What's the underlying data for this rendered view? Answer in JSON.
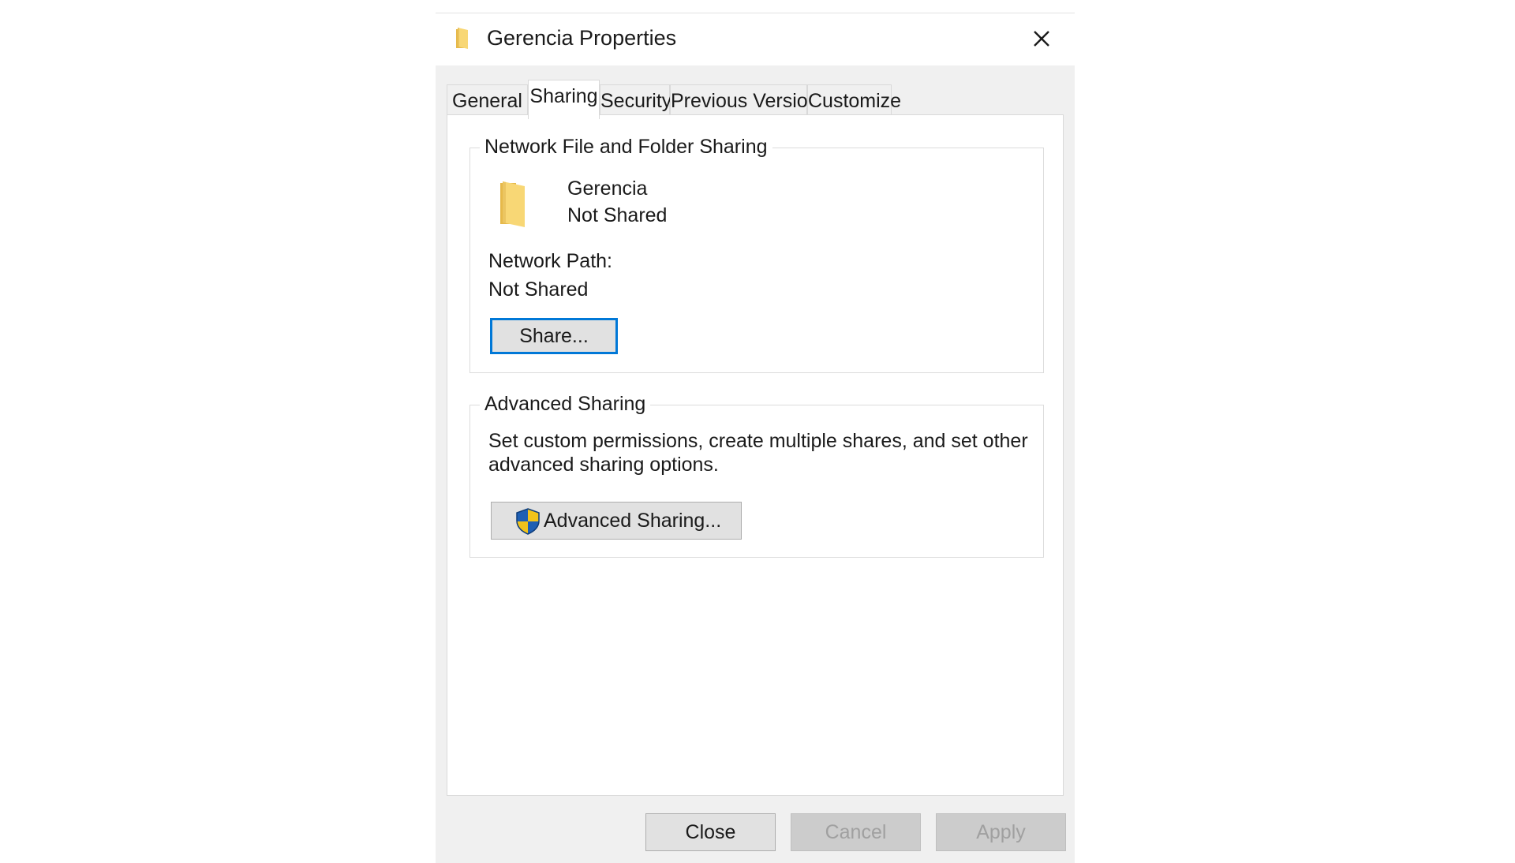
{
  "window": {
    "title": "Gerencia Properties",
    "icon": "folder-icon",
    "close_icon": "close-icon"
  },
  "tabs": [
    {
      "label": "General",
      "active": false
    },
    {
      "label": "Sharing",
      "active": true
    },
    {
      "label": "Security",
      "active": false
    },
    {
      "label": "Previous Versions",
      "active": false
    },
    {
      "label": "Customize",
      "active": false
    }
  ],
  "network_sharing": {
    "group_label": "Network File and Folder Sharing",
    "folder_icon": "folder-icon",
    "folder_name": "Gerencia",
    "folder_status": "Not Shared",
    "path_label": "Network Path:",
    "path_value": "Not Shared",
    "share_button": "Share..."
  },
  "advanced_sharing": {
    "group_label": "Advanced Sharing",
    "description_line1": "Set custom permissions, create multiple shares, and set other",
    "description_line2": "advanced sharing options.",
    "button_icon": "uac-shield-icon",
    "button_label": "Advanced Sharing..."
  },
  "footer": {
    "close_label": "Close",
    "cancel_label": "Cancel",
    "apply_label": "Apply"
  },
  "colors": {
    "focus_border": "#0078d7",
    "folder_yellow": "#f8d775",
    "shield_blue": "#1e5fb4",
    "shield_yellow": "#f2c31b"
  }
}
